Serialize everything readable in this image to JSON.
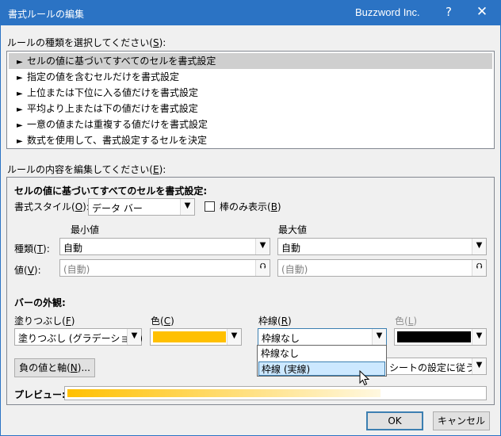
{
  "titlebar": {
    "title": "書式ルールの編集",
    "brand": "Buzzword Inc.",
    "help": "?",
    "close": "✕"
  },
  "rule_type": {
    "label": "ルールの種類を選択してください(",
    "label_key": "S",
    "label_end": "):",
    "items": [
      "セルの値に基づいてすべてのセルを書式設定",
      "指定の値を含むセルだけを書式設定",
      "上位または下位に入る値だけを書式設定",
      "平均より上または下の値だけを書式設定",
      "一意の値または重複する値だけを書式設定",
      "数式を使用して、書式設定するセルを決定"
    ],
    "arrow": "►"
  },
  "rule_edit": {
    "label": "ルールの内容を編集してください(",
    "label_key": "E",
    "label_end": "):",
    "heading": "セルの値に基づいてすべてのセルを書式設定:",
    "format_style_label": "書式スタイル(",
    "format_style_key": "O",
    "format_style_end": "):",
    "format_style_value": "データ バー",
    "bar_only_label": "棒のみ表示(",
    "bar_only_key": "B",
    "bar_only_end": ")",
    "min_label": "最小値",
    "max_label": "最大値",
    "type_label": "種類(",
    "type_key": "T",
    "type_end": "):",
    "value_label": "値(",
    "value_key": "V",
    "value_end": "):",
    "min_type": "自動",
    "max_type": "自動",
    "min_value": "(自動)",
    "max_value": "(自動)",
    "bar_appearance": "バーの外観:",
    "fill_label": "塗りつぶし(",
    "fill_key": "F",
    "fill_end": ")",
    "fill_value": "塗りつぶし (グラデーション)",
    "color_label": "色(",
    "color_key": "C",
    "color_end": ")",
    "border_label": "枠線(",
    "border_key": "R",
    "border_end": ")",
    "border_value": "枠線なし",
    "border_color_label": "色(",
    "border_color_key": "L",
    "border_color_end": ")",
    "border_options": [
      "枠線なし",
      "枠線 (実線)"
    ],
    "negative_button": "負の値と軸(",
    "negative_key": "N",
    "negative_end": ")...",
    "direction_value": "シートの設定に従う",
    "preview_label": "プレビュー:",
    "fill_color": "#ffc000",
    "border_color": "#000000"
  },
  "buttons": {
    "ok": "OK",
    "cancel": "キャンセル"
  },
  "icons": {
    "dropdown": "▼",
    "upload": "⮉"
  }
}
